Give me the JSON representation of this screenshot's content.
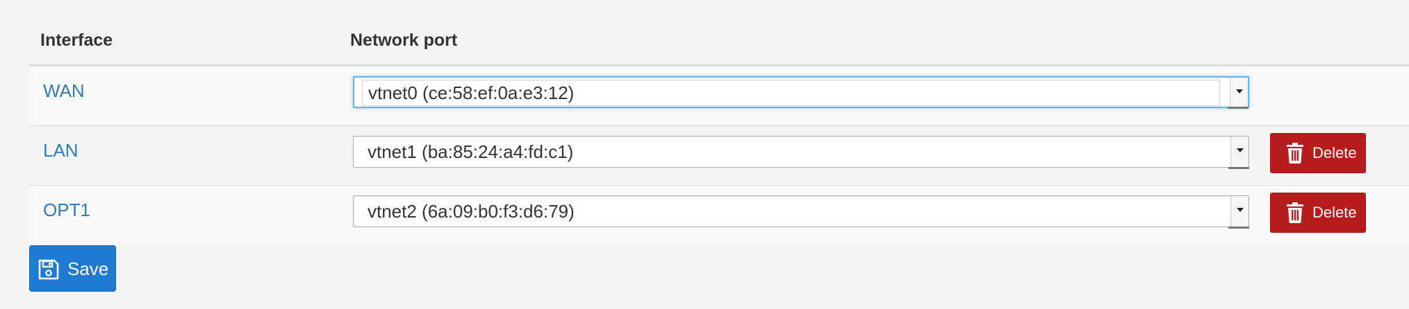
{
  "table": {
    "headers": {
      "interface": "Interface",
      "network_port": "Network port"
    },
    "rows": [
      {
        "interface": "WAN",
        "port": "vtnet0 (ce:58:ef:0a:e3:12)",
        "focused": true,
        "deletable": false
      },
      {
        "interface": "LAN",
        "port": "vtnet1 (ba:85:24:a4:fd:c1)",
        "focused": false,
        "deletable": true,
        "delete_label": "Delete"
      },
      {
        "interface": "OPT1",
        "port": "vtnet2 (6a:09:b0:f3:d6:79)",
        "focused": false,
        "deletable": true,
        "delete_label": "Delete"
      }
    ]
  },
  "save_button": {
    "label": "Save",
    "icon": "save-icon"
  },
  "colors": {
    "link": "#337ab7",
    "delete": "#b71c1c",
    "save": "#1e7ad3",
    "focus": "#66afe9"
  },
  "icons": {
    "delete": "trash-icon",
    "save": "save-icon",
    "dropdown": "chevron-down-icon"
  }
}
